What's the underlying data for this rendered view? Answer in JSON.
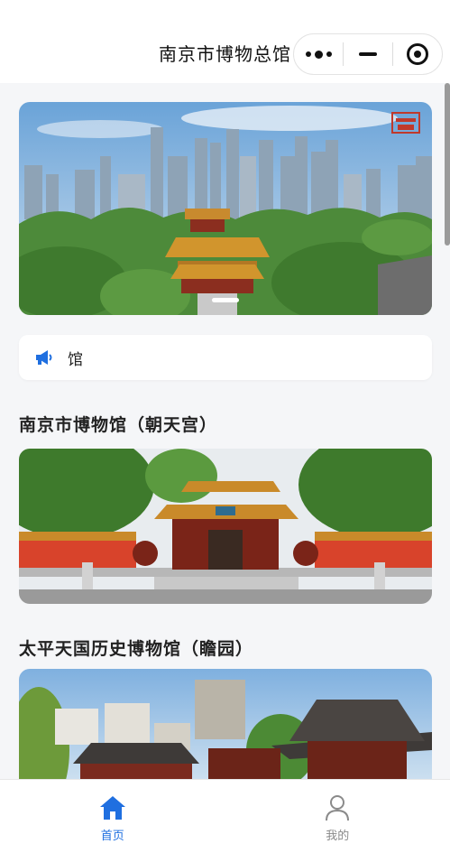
{
  "nav": {
    "title": "南京市博物总馆",
    "more_icon": "more-dots-icon",
    "minimize_icon": "minimize-icon",
    "close_icon": "target-close-icon"
  },
  "banner": {
    "logo_icon": "museum-logo-icon",
    "active_index": 0
  },
  "notice": {
    "icon": "megaphone-icon",
    "text": "馆"
  },
  "sections": [
    {
      "title": "南京市博物馆（朝天宫）"
    },
    {
      "title": "太平天国历史博物馆（瞻园）"
    }
  ],
  "tabbar": {
    "items": [
      {
        "label": "首页",
        "icon": "home-icon",
        "active": true
      },
      {
        "label": "我的",
        "icon": "user-icon",
        "active": false
      }
    ]
  },
  "colors": {
    "accent": "#1f6fe0",
    "inactive": "#8a8a8a",
    "wall_red": "#d8432b",
    "roof_gold": "#c98a2a"
  }
}
